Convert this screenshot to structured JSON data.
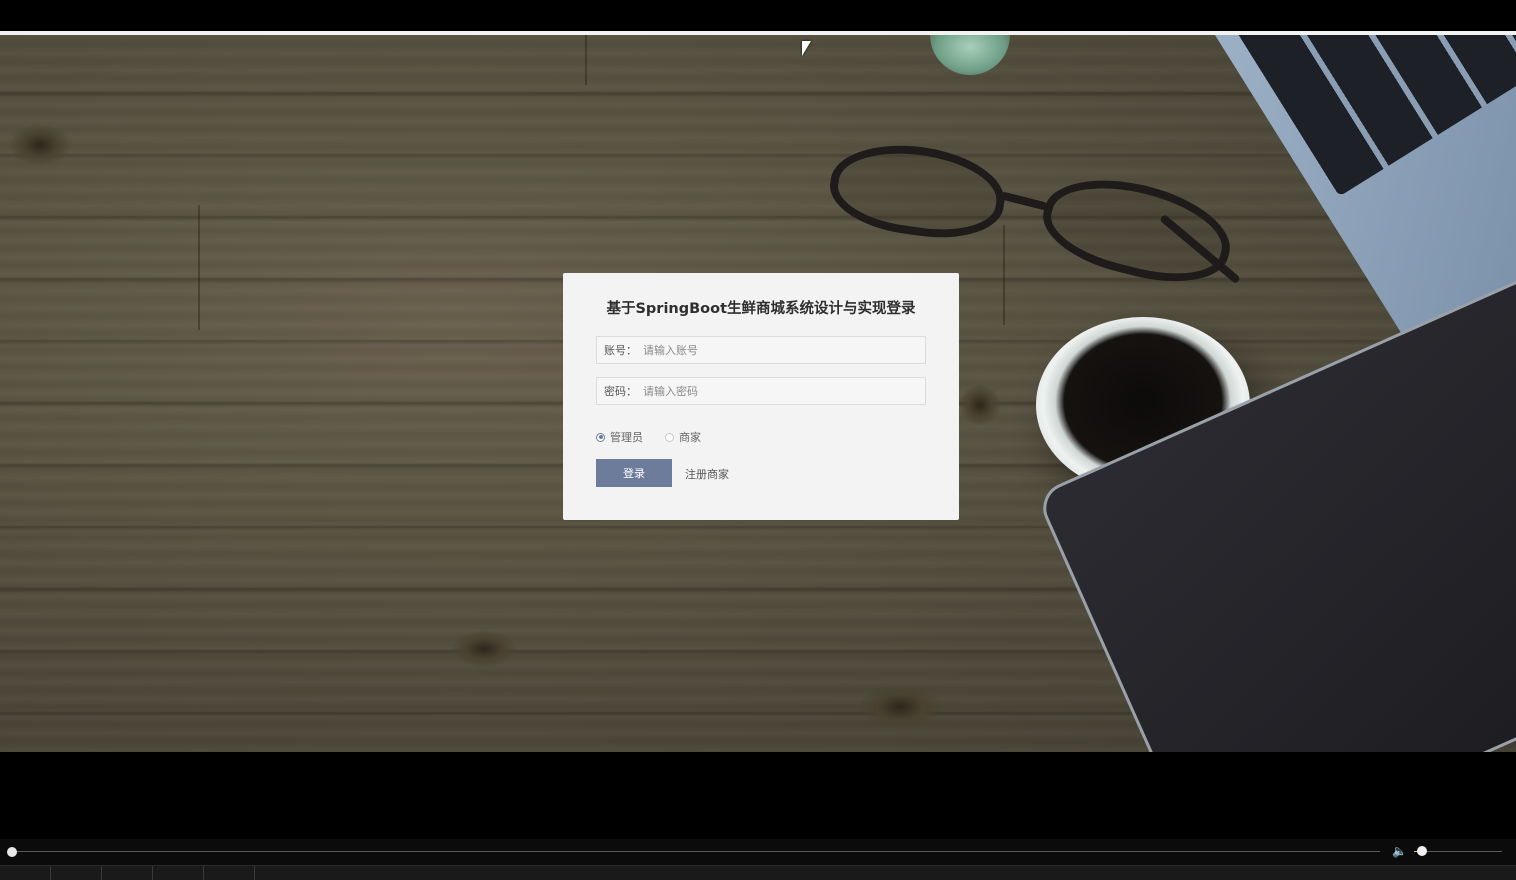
{
  "login": {
    "title": "基于SpringBoot生鲜商城系统设计与实现登录",
    "account_label": "账号：",
    "account_placeholder": "请输入账号",
    "password_label": "密码：",
    "password_placeholder": "请输入密码",
    "roles": [
      {
        "label": "管理员",
        "selected": true
      },
      {
        "label": "商家",
        "selected": false
      }
    ],
    "login_button": "登录",
    "register_link": "注册商家"
  },
  "player": {
    "progress": 0.0,
    "volume": 0.09
  },
  "taskbar": {
    "slot_count": 5
  },
  "colors": {
    "button": "#6e7c9c",
    "card": "#f3f3f3"
  }
}
